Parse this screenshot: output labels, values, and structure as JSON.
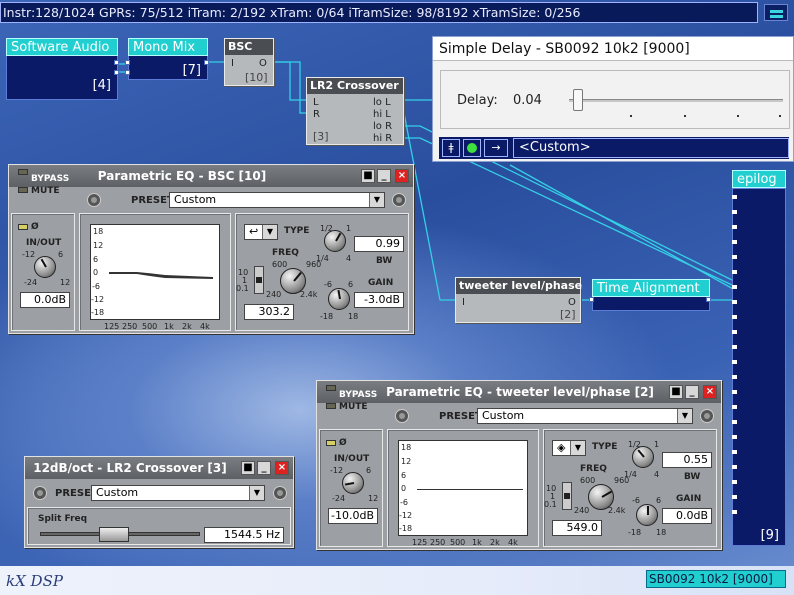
{
  "status_bar": "Instr:128/1024 GPRs: 75/512 iTram: 2/192 xTram: 0/64 iTramSize: 98/8192 xTramSize: 0/256",
  "blocks": {
    "software_audio": {
      "title": "Software Audio",
      "index": "[4]"
    },
    "mono_mix": {
      "title": "Mono Mix",
      "index": "[7]"
    },
    "bsc": {
      "title": "BSC",
      "in": "I",
      "out": "O",
      "index": "[10]"
    },
    "lr2": {
      "title": "LR2 Crossover",
      "in_l": "L",
      "in_r": "R",
      "out1": "lo L",
      "out2": "hi L",
      "out3": "lo R",
      "out4": "hi R",
      "index": "[3]"
    },
    "tweeter": {
      "title": "tweeter level/phase",
      "in": "I",
      "out": "O",
      "index": "[2]"
    },
    "time_alignment": {
      "title": "Time Alignment"
    },
    "epilog": {
      "title": "epilog",
      "index": "[9]"
    }
  },
  "delay": {
    "title": "Simple Delay - SB0092 10k2 [9000]",
    "label": "Delay:",
    "value": "0.04",
    "value_fraction": 0.02,
    "preset": "<Custom>"
  },
  "eq_bsc": {
    "title": "Parametric EQ - BSC [10]",
    "bypass": "BYPASS",
    "mute": "MUTE",
    "preset_label": "PRESET",
    "preset": "Custom",
    "phase": "Ø",
    "inout": "IN/OUT",
    "inout_value": "0.0dB",
    "type": "TYPE",
    "freq": "FREQ",
    "freq_value": "303.2",
    "bw": "BW",
    "bw_value": "0.99",
    "gain": "GAIN",
    "gain_value": "-3.0dB"
  },
  "eq_tweeter": {
    "title": "Parametric EQ - tweeter level/phase [2]",
    "bypass": "BYPASS",
    "mute": "MUTE",
    "preset_label": "PRESET",
    "preset": "Custom",
    "phase": "Ø",
    "inout": "IN/OUT",
    "inout_value": "-10.0dB",
    "type": "TYPE",
    "freq": "FREQ",
    "freq_value": "549.0",
    "bw": "BW",
    "bw_value": "0.55",
    "gain": "GAIN",
    "gain_value": "0.0dB"
  },
  "graph_labels": {
    "y": [
      "18",
      "12",
      "6",
      "0",
      "-6",
      "-12",
      "-18"
    ],
    "x": [
      "125",
      "250",
      "500",
      "1k",
      "2k",
      "4k"
    ]
  },
  "knob_scales": {
    "inout": [
      "-12",
      "6",
      "-24",
      "12"
    ],
    "freq": [
      "600",
      "960",
      "240",
      "2.4k"
    ],
    "bw": [
      "1/2",
      "1",
      "1/4",
      "4"
    ],
    "gain": [
      "-6",
      "6",
      "-18",
      "18"
    ],
    "freq_range": [
      "10",
      "1",
      "0.1"
    ]
  },
  "crossover": {
    "title": "12dB/oct - LR2 Crossover [3]",
    "preset_label": "PRESET",
    "preset": "Custom",
    "split_label": "Split Freq",
    "split_value": "1544.5 Hz",
    "split_fraction": 0.45
  },
  "logo": "kX DSP",
  "status_right": "SB0092 10k2 [9000]"
}
